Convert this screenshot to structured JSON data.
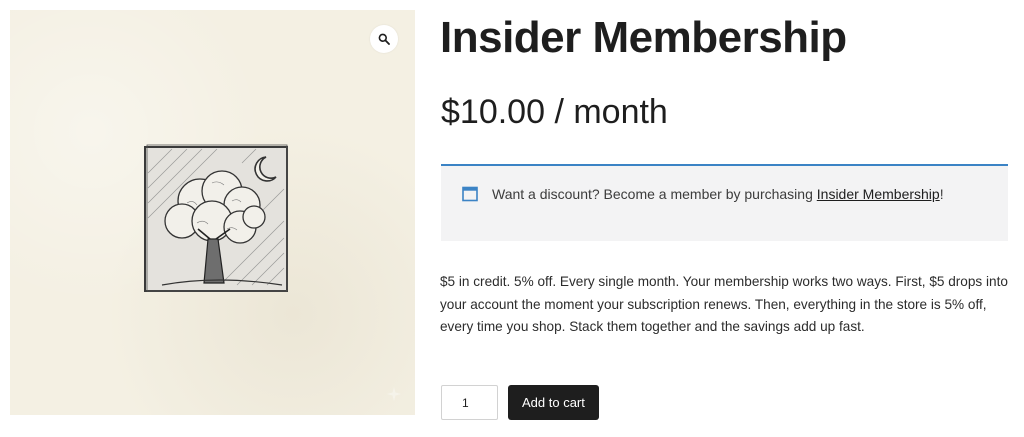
{
  "product": {
    "title": "Insider Membership",
    "price": "$10.00 / month",
    "description": "$5 in credit. 5% off. Every single month. Your membership works two ways. First, $5 drops into your account the moment your subscription renews. Then, everything in the store is 5% off, every time you shop. Stack them together and the savings add up fast."
  },
  "gallery": {
    "zoom_icon": "magnifier-icon",
    "image": "tree-moon-sketch"
  },
  "notice": {
    "icon": "window-icon",
    "text_before": "Want a discount? Become a member by purchasing ",
    "link_text": "Insider Membership",
    "text_after": "!"
  },
  "cart": {
    "quantity": "1",
    "button_label": "Add to cart"
  },
  "colors": {
    "notice_border": "#3b83c5",
    "button_bg": "#1e1e1e",
    "gallery_bg": "#f4f0e3"
  }
}
